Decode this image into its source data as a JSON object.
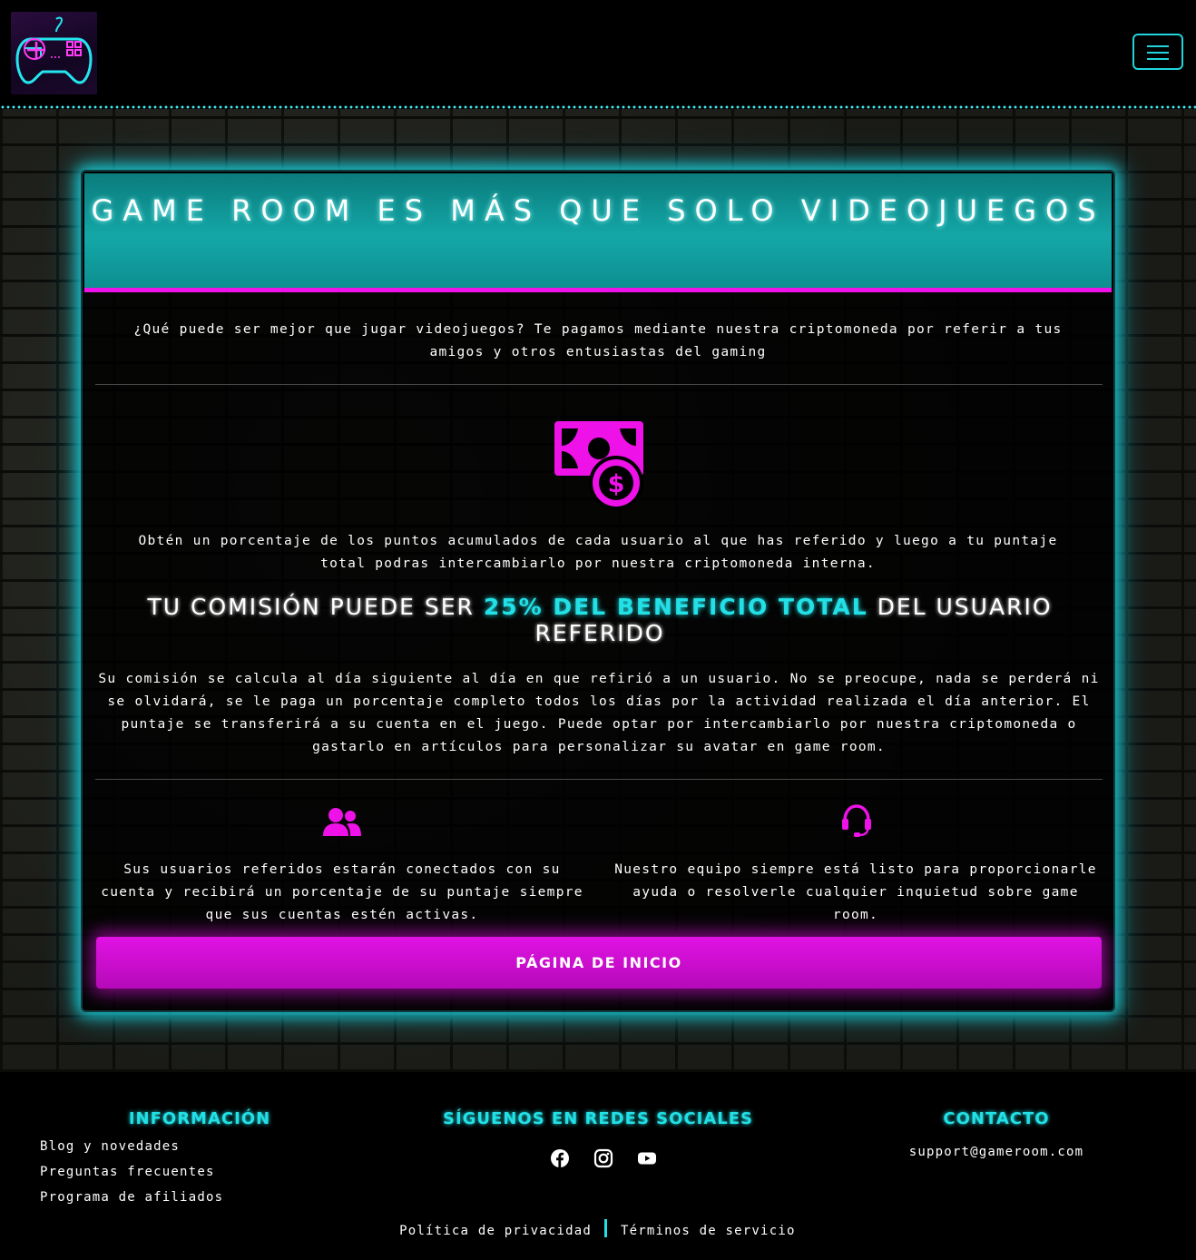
{
  "header": {
    "logo_icon": "gamepad-neon-icon",
    "menu_icon": "hamburger-menu-icon"
  },
  "card": {
    "title": "GAME ROOM ES MÁS QUE SOLO VIDEOJUEGOS",
    "intro": "¿Qué puede ser mejor que jugar videojuegos? Te pagamos mediante nuestra criptomoneda por referir a tus amigos y otros entusiastas del gaming",
    "money_icon": "money-bill-dollar-icon",
    "percentage_text": "Obtén un porcentaje de los puntos acumulados de cada usuario al que has referido y luego a tu puntaje total podras intercambiarlo por nuestra criptomoneda interna.",
    "commission_prefix": "TU COMISIÓN PUEDE SER ",
    "commission_highlight": "25% DEL BENEFICIO TOTAL",
    "commission_suffix": " DEL USUARIO REFERIDO",
    "detail": "Su comisión se calcula al día siguiente al día en que refirió a un usuario. No se preocupe, nada se perderá ni se olvidará, se le paga un porcentaje completo todos los días por la actividad realizada el día anterior. El puntaje se transferirá a su cuenta en el juego. Puede optar por intercambiarlo por nuestra criptomoneda o gastarlo en artículos para personalizar su avatar en game room.",
    "feature_users_icon": "users-icon",
    "feature_users_text": "Sus usuarios referidos estarán conectados con su cuenta y recibirá un porcentaje de su puntaje siempre que sus cuentas estén activas.",
    "feature_support_icon": "headset-icon",
    "feature_support_text": "Nuestro equipo siempre está listo para proporcionarle ayuda o resolverle cualquier inquietud sobre game room.",
    "home_button": "PÁGINA DE INICIO"
  },
  "footer": {
    "info_heading": "INFORMACIÓN",
    "info_links": [
      "Blog y novedades",
      "Preguntas frecuentes",
      "Programa de afiliados"
    ],
    "social_heading": "SÍGUENOS EN REDES SOCIALES",
    "social_icons": [
      "facebook-icon",
      "instagram-icon",
      "youtube-icon"
    ],
    "contact_heading": "CONTACTO",
    "contact_email": "support@gameroom.com",
    "privacy": "Política de privacidad",
    "terms": "Términos de servicio"
  },
  "colors": {
    "cyan": "#22e0e6",
    "magenta": "#ee12e8",
    "teal_header": "#14a7a7",
    "background": "#000000"
  }
}
